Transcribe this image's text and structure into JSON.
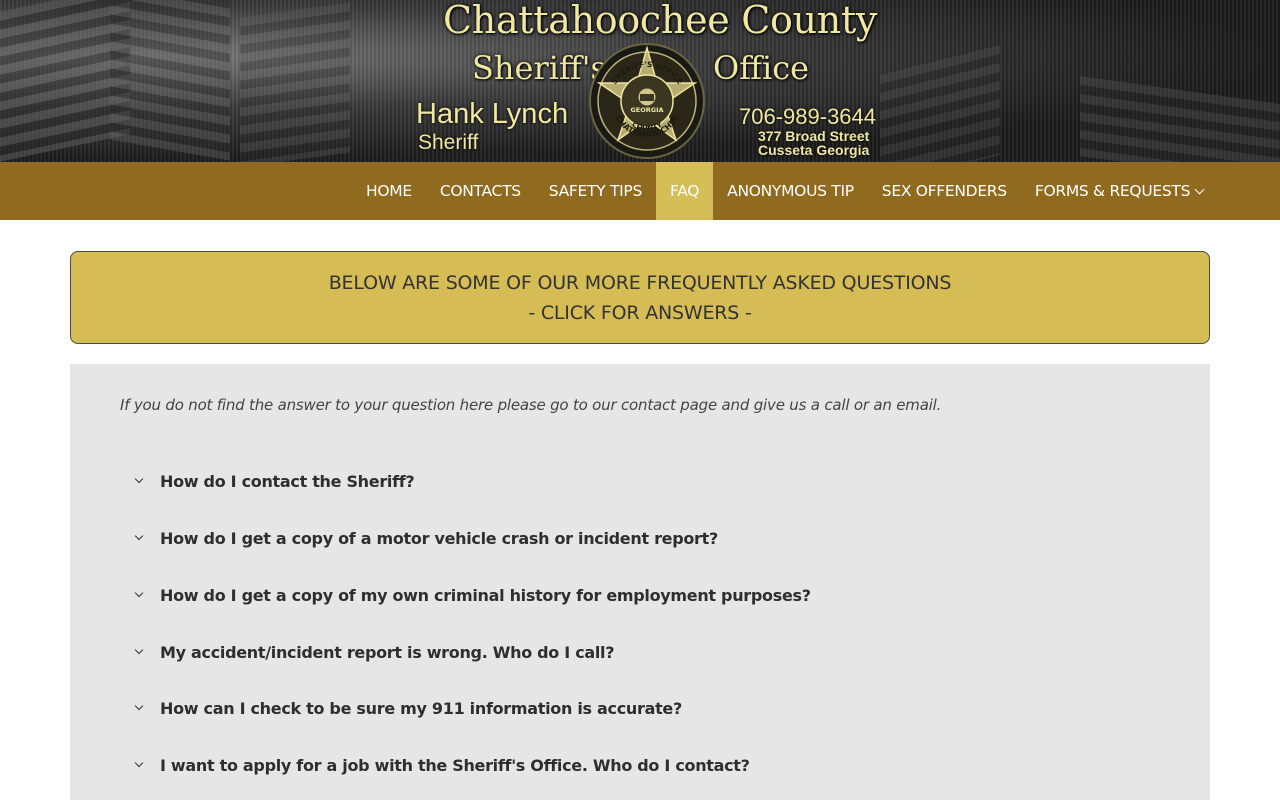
{
  "header": {
    "title_line1": "Chattahoochee County",
    "title_sheriffs": "Sheriff's",
    "title_office": "Office",
    "sheriff_name": "Hank Lynch",
    "sheriff_role": "Sheriff",
    "phone": "706-989-3644",
    "address_line1": "377 Broad Street",
    "address_line2": "Cusseta Georgia",
    "badge": {
      "top_text": "SHERIFF'S OFFICE",
      "center_text": "GEORGIA",
      "bottom_text": "CHATTAHOOCHEE",
      "county_text": "COUNTY"
    }
  },
  "nav": {
    "items": [
      {
        "label": "HOME"
      },
      {
        "label": "CONTACTS"
      },
      {
        "label": "SAFETY TIPS"
      },
      {
        "label": "FAQ",
        "active": true
      },
      {
        "label": "ANONYMOUS TIP"
      },
      {
        "label": "SEX OFFENDERS"
      },
      {
        "label": "FORMS & REQUESTS",
        "has_dropdown": true
      }
    ]
  },
  "callout": {
    "line1": "BELOW ARE SOME OF OUR MORE FREQUENTLY ASKED QUESTIONS",
    "line2": "- CLICK FOR ANSWERS -"
  },
  "faq": {
    "intro": "If you do not find the answer to your question here please go to our contact page and give us a call or an email.",
    "questions": [
      "How do I contact the Sheriff?",
      "How do I get a copy of a motor vehicle crash or incident report?",
      "How do I get a copy of my own criminal history for employment purposes?",
      "My accident/incident report is wrong. Who do I call?",
      "How can I check to be sure my 911 information is accurate?",
      "I want to apply for a job with the Sheriff's Office. Who do I contact?"
    ]
  },
  "colors": {
    "nav_bg": "#8f6a1f",
    "nav_active": "#d6be57",
    "callout_bg": "#d6bc55",
    "panel_bg": "#e6e6e6",
    "title_text": "#f0e7a0"
  }
}
